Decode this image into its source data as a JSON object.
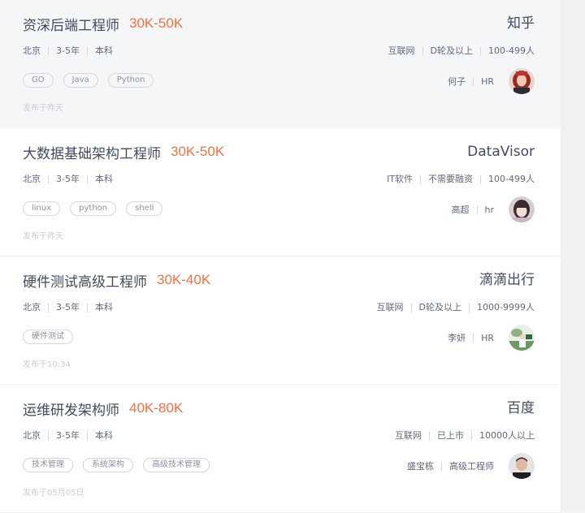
{
  "jobs": [
    {
      "title": "资深后端工程师",
      "salary": "30K-50K",
      "company": "知乎",
      "location": "北京",
      "experience": "3-5年",
      "education": "本科",
      "industry": "互联网",
      "stage": "D轮及以上",
      "size": "100-499人",
      "tags": [
        "GO",
        "Java",
        "Python"
      ],
      "recruiter_name": "何子",
      "recruiter_title": "HR",
      "publish_time": "发布于昨天",
      "avatar_icon": "woman-red-hair-avatar"
    },
    {
      "title": "大数据基础架构工程师",
      "salary": "30K-50K",
      "company": "DataVisor",
      "location": "北京",
      "experience": "3-5年",
      "education": "本科",
      "industry": "IT软件",
      "stage": "不需要融资",
      "size": "100-499人",
      "tags": [
        "linux",
        "python",
        "shell"
      ],
      "recruiter_name": "高超",
      "recruiter_title": "hr",
      "publish_time": "发布于昨天",
      "avatar_icon": "girl-bangs-avatar"
    },
    {
      "title": "硬件测试高级工程师",
      "salary": "30K-40K",
      "company": "滴滴出行",
      "location": "北京",
      "experience": "3-5年",
      "education": "本科",
      "industry": "互联网",
      "stage": "D轮及以上",
      "size": "1000-9999人",
      "tags": [
        "硬件测试"
      ],
      "recruiter_name": "李妍",
      "recruiter_title": "HR",
      "publish_time": "发布于10:34",
      "avatar_icon": "outdoor-photo-avatar"
    },
    {
      "title": "运维研发架构师",
      "salary": "40K-80K",
      "company": "百度",
      "location": "北京",
      "experience": "3-5年",
      "education": "本科",
      "industry": "互联网",
      "stage": "已上市",
      "size": "10000人以上",
      "tags": [
        "技术管理",
        "系统架构",
        "高级技术管理"
      ],
      "recruiter_name": "盛宝栋",
      "recruiter_title": "高级工程师",
      "publish_time": "发布于05月05日",
      "avatar_icon": "man-short-hair-avatar"
    }
  ],
  "colors": {
    "salary": "#fc703e",
    "title": "#414a60",
    "meta": "#61687c",
    "tag_text": "#8d92a1",
    "time": "#c9ccd3",
    "active_card_bg": "#f5f6f8"
  }
}
